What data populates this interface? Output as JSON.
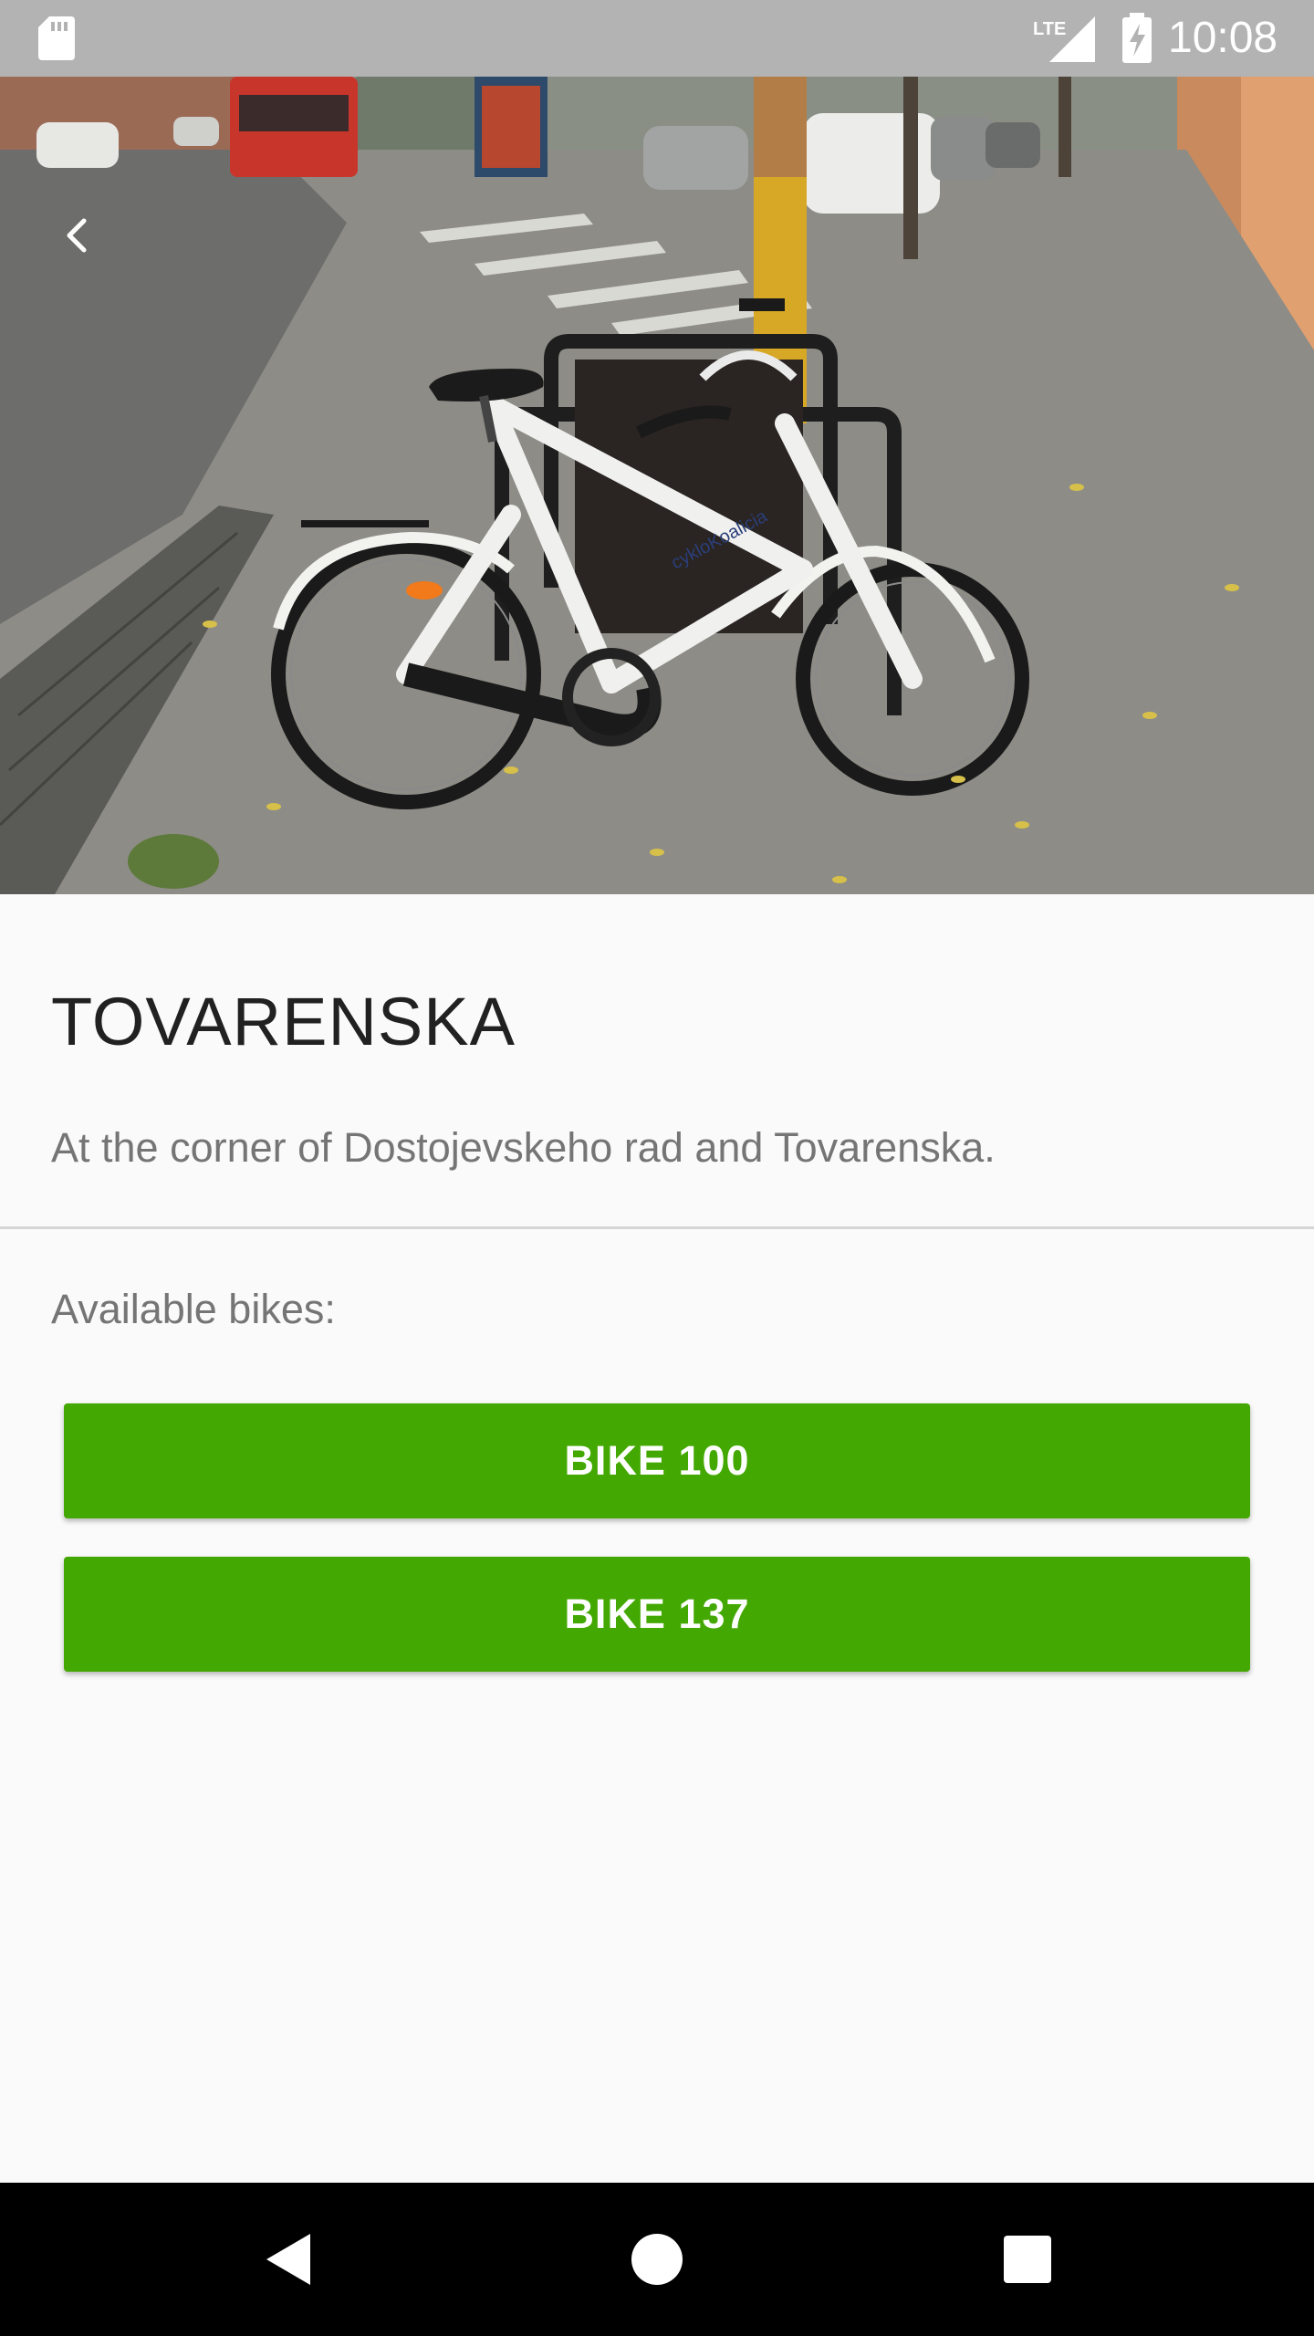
{
  "status_bar": {
    "time": "10:08",
    "network": "LTE",
    "icons": [
      "sd-card-icon",
      "lte-signal-icon",
      "battery-charging-icon"
    ]
  },
  "header": {
    "back_icon": "arrow-back-icon",
    "photo_description_icon": "station-photo"
  },
  "station": {
    "name": "TOVARENSKA",
    "description": "At the corner of Dostojevskeho rad and Tovarenska."
  },
  "bikes": {
    "label": "Available bikes:",
    "items": [
      {
        "label": "BIKE 100"
      },
      {
        "label": "BIKE 137"
      }
    ]
  },
  "nav_bar": {
    "icons": [
      "nav-back-icon",
      "nav-home-icon",
      "nav-recents-icon"
    ]
  },
  "colors": {
    "status_bar": "#b3b3b3",
    "button_green": "#43a802",
    "nav_bar": "#000000",
    "background": "#fafafa"
  }
}
